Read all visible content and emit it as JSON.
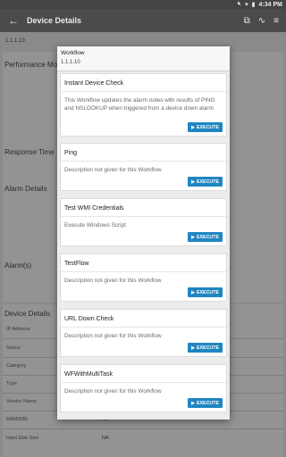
{
  "status_bar": {
    "time": "4:34 PM",
    "icons": [
      "mute-icon",
      "wifi-icon",
      "battery-icon"
    ]
  },
  "app_bar": {
    "title": "Device Details",
    "back_icon": "arrow-back-icon",
    "actions": [
      "link-icon",
      "workflow-icon",
      "sliders-icon"
    ]
  },
  "background": {
    "ip": "1.1.1.10",
    "sections": [
      "Performance Mo",
      "Response Time",
      "Alarm Details",
      "Alarm(s)",
      "Device Details"
    ],
    "device_rows": [
      {
        "label": "IP Address",
        "value": ""
      },
      {
        "label": "Status",
        "value": ""
      },
      {
        "label": "Category",
        "value": ""
      },
      {
        "label": "Type",
        "value": ""
      },
      {
        "label": "Vendor Name",
        "value": ""
      },
      {
        "label": "RAM(MB)",
        "value": "NA"
      },
      {
        "label": "Hard Disk Size",
        "value": "NA"
      }
    ]
  },
  "dialog": {
    "title": "Workflow",
    "subtitle": "1.1.1.10",
    "execute_label": "EXECUTE",
    "workflows": [
      {
        "name": "Instant Device Check",
        "description": "This Workflow updates the alarm notes with results of PING and NSLOOKUP when triggered from a device down alarm"
      },
      {
        "name": "Ping",
        "description": "Description not given for this Workflow"
      },
      {
        "name": "Test WMI Credentials",
        "description": "Execute Windows Script"
      },
      {
        "name": "TestFlow",
        "description": "Description not given for this Workflow"
      },
      {
        "name": "URL Down Check",
        "description": "Description not given for this Workflow"
      },
      {
        "name": "WFWithMultiTask",
        "description": "Description not given for this Workflow"
      }
    ]
  }
}
